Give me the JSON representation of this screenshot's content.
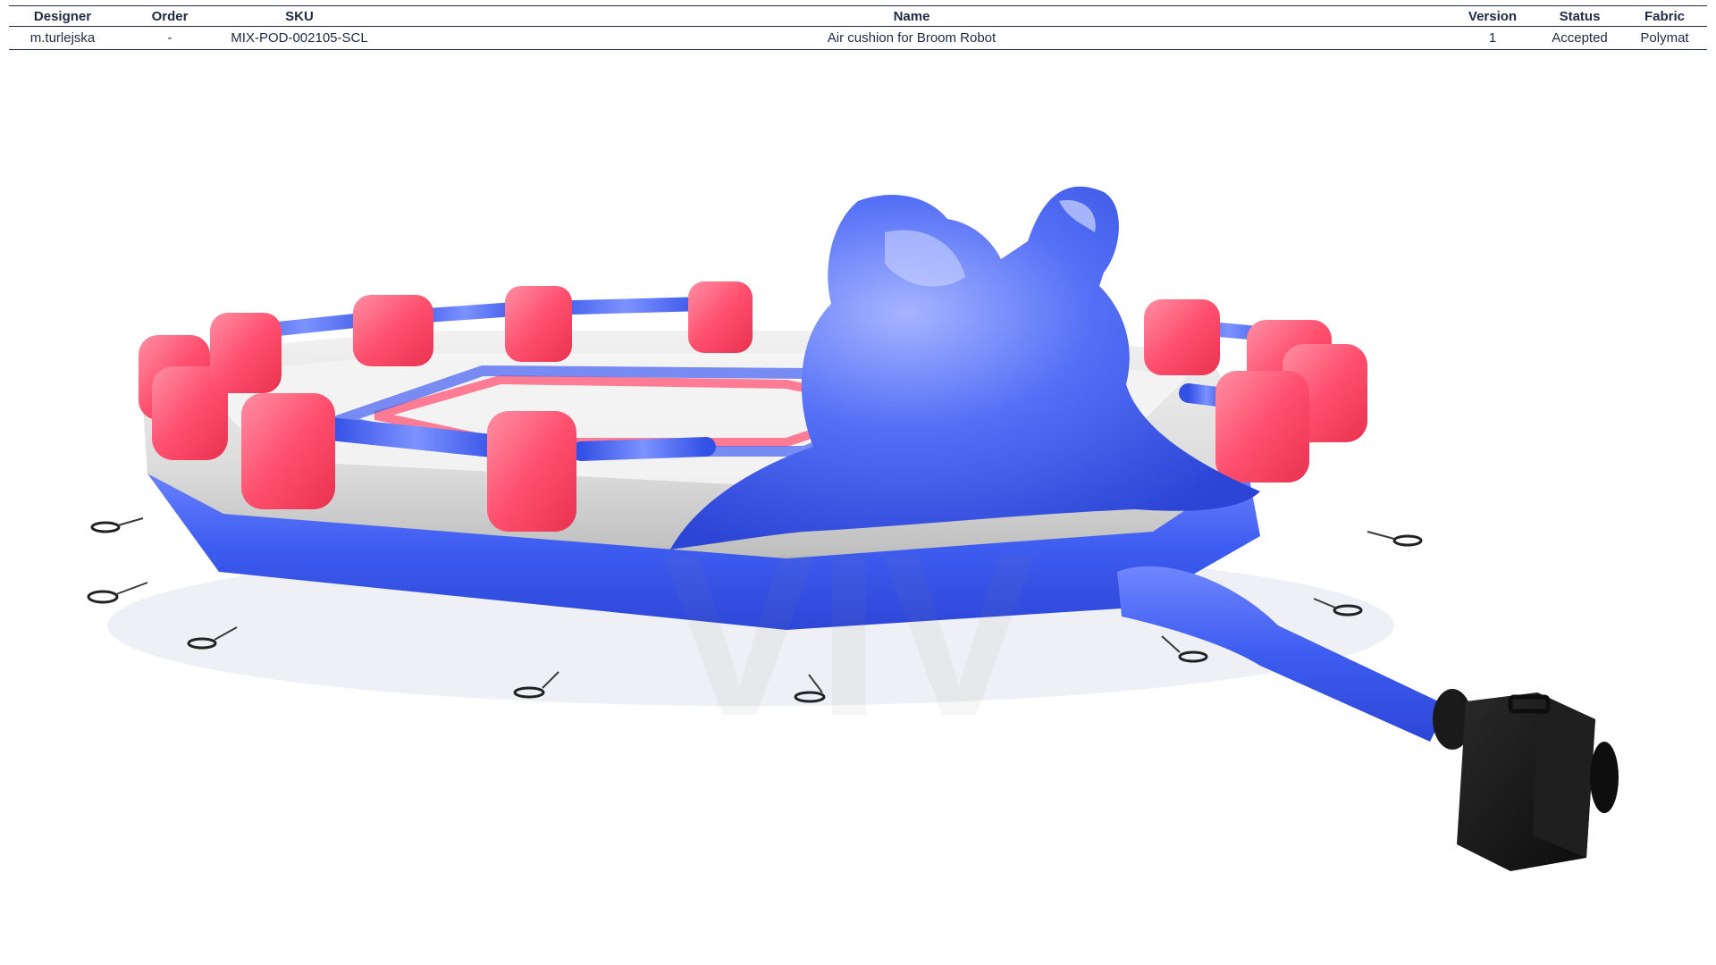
{
  "spec_table": {
    "headers": {
      "designer": "Designer",
      "order": "Order",
      "sku": "SKU",
      "name": "Name",
      "version": "Version",
      "status": "Status",
      "fabric": "Fabric"
    },
    "row": {
      "designer": "m.turlejska",
      "order": "-",
      "sku": "MIX-POD-002105-SCL",
      "name": "Air cushion for Broom Robot",
      "version": "1",
      "status": "Accepted",
      "fabric": "Polymat"
    }
  },
  "watermark": {
    "text": "VIV"
  },
  "colors": {
    "header_text": "#1f2a44",
    "inflatable_blue": "#3d5cf0",
    "inflatable_red": "#ff4f6e",
    "inflatable_white": "#e6e6e6",
    "blower_black": "#151515"
  },
  "product": {
    "parts": [
      "octagon-arena",
      "red-posts",
      "blue-rails",
      "robot-head",
      "air-tube",
      "blower",
      "anchor-rings"
    ]
  }
}
